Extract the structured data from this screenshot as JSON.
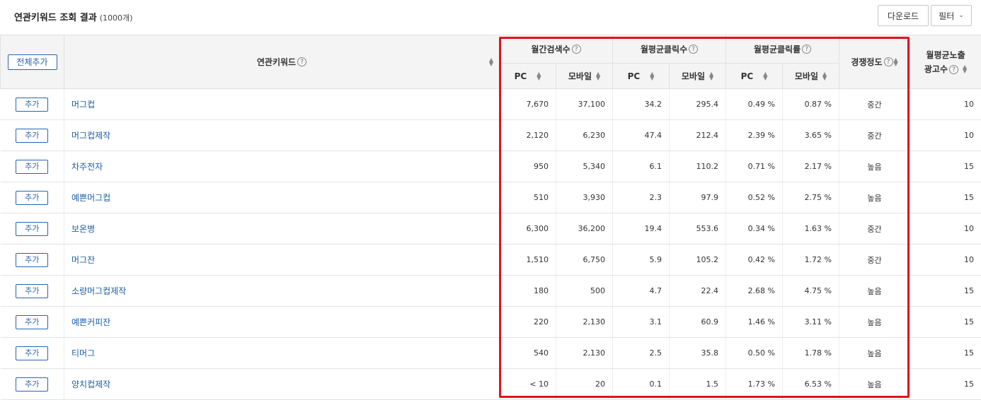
{
  "header": {
    "title": "연관키워드 조회 결과",
    "count": "(1000개)",
    "download_label": "다운로드",
    "filter_label": "필터"
  },
  "columns": {
    "add_all": "전체추가",
    "keyword": "연관키워드",
    "monthly_search": "월간검색수",
    "avg_clicks": "월평균클릭수",
    "avg_ctr": "월평균클릭률",
    "competition": "경쟁정도",
    "avg_ads_line1": "월평균노출",
    "avg_ads_line2": "광고수",
    "pc": "PC",
    "mobile": "모바일"
  },
  "add_label": "추가",
  "rows": [
    {
      "keyword": "머그컵",
      "search_pc": "7,670",
      "search_mobile": "37,100",
      "click_pc": "34.2",
      "click_mobile": "295.4",
      "ctr_pc": "0.49 %",
      "ctr_mobile": "0.87 %",
      "competition": "중간",
      "ads": "10"
    },
    {
      "keyword": "머그컵제작",
      "search_pc": "2,120",
      "search_mobile": "6,230",
      "click_pc": "47.4",
      "click_mobile": "212.4",
      "ctr_pc": "2.39 %",
      "ctr_mobile": "3.65 %",
      "competition": "중간",
      "ads": "10"
    },
    {
      "keyword": "차주전자",
      "search_pc": "950",
      "search_mobile": "5,340",
      "click_pc": "6.1",
      "click_mobile": "110.2",
      "ctr_pc": "0.71 %",
      "ctr_mobile": "2.17 %",
      "competition": "높음",
      "ads": "15"
    },
    {
      "keyword": "예쁜머그컵",
      "search_pc": "510",
      "search_mobile": "3,930",
      "click_pc": "2.3",
      "click_mobile": "97.9",
      "ctr_pc": "0.52 %",
      "ctr_mobile": "2.75 %",
      "competition": "높음",
      "ads": "15"
    },
    {
      "keyword": "보온병",
      "search_pc": "6,300",
      "search_mobile": "36,200",
      "click_pc": "19.4",
      "click_mobile": "553.6",
      "ctr_pc": "0.34 %",
      "ctr_mobile": "1.63 %",
      "competition": "중간",
      "ads": "10"
    },
    {
      "keyword": "머그잔",
      "search_pc": "1,510",
      "search_mobile": "6,750",
      "click_pc": "5.9",
      "click_mobile": "105.2",
      "ctr_pc": "0.42 %",
      "ctr_mobile": "1.72 %",
      "competition": "중간",
      "ads": "10"
    },
    {
      "keyword": "소량머그컵제작",
      "search_pc": "180",
      "search_mobile": "500",
      "click_pc": "4.7",
      "click_mobile": "22.4",
      "ctr_pc": "2.68 %",
      "ctr_mobile": "4.75 %",
      "competition": "높음",
      "ads": "15"
    },
    {
      "keyword": "예쁜커피잔",
      "search_pc": "220",
      "search_mobile": "2,130",
      "click_pc": "3.1",
      "click_mobile": "60.9",
      "ctr_pc": "1.46 %",
      "ctr_mobile": "3.11 %",
      "competition": "높음",
      "ads": "15"
    },
    {
      "keyword": "티머그",
      "search_pc": "540",
      "search_mobile": "2,130",
      "click_pc": "2.5",
      "click_mobile": "35.8",
      "ctr_pc": "0.50 %",
      "ctr_mobile": "1.78 %",
      "competition": "높음",
      "ads": "15"
    },
    {
      "keyword": "양치컵제작",
      "search_pc": "< 10",
      "search_mobile": "20",
      "click_pc": "0.1",
      "click_mobile": "1.5",
      "ctr_pc": "1.73 %",
      "ctr_mobile": "6.53 %",
      "competition": "높음",
      "ads": "15"
    }
  ],
  "icons": {
    "help": "question-circle-icon",
    "sort": "sort-updown-icon",
    "chevron": "chevron-down-icon"
  },
  "colors": {
    "highlight": "#e0131b",
    "link": "#1a5ea8",
    "button_border": "#2a63b0"
  }
}
